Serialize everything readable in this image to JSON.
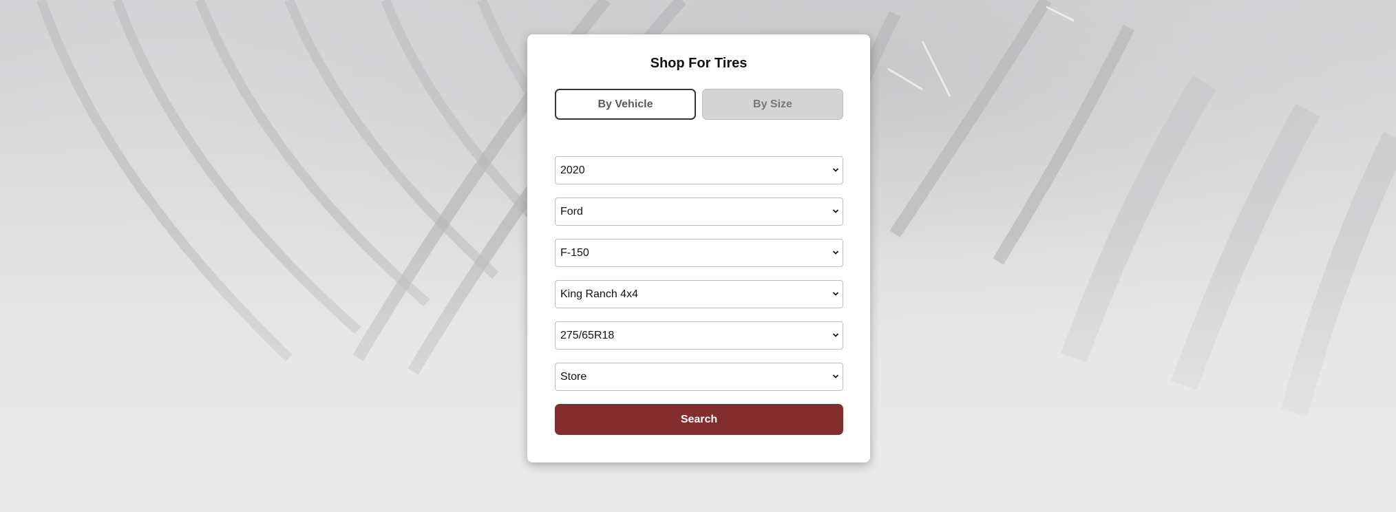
{
  "form": {
    "title": "Shop For Tires",
    "tabs": [
      {
        "label": "By Vehicle",
        "active": true
      },
      {
        "label": "By Size",
        "active": false
      }
    ],
    "fields": [
      {
        "name": "year",
        "value": "2020"
      },
      {
        "name": "make",
        "value": "Ford"
      },
      {
        "name": "model",
        "value": "F-150"
      },
      {
        "name": "trim",
        "value": "King Ranch 4x4"
      },
      {
        "name": "tire-size",
        "value": "275/65R18"
      },
      {
        "name": "store",
        "value": "Store"
      }
    ],
    "search_label": "Search"
  },
  "colors": {
    "search_button": "#832e2d",
    "background": "#e9e9ea",
    "card": "#ffffff"
  },
  "icons": {
    "field_dropdown": "chevron-down-icon"
  }
}
